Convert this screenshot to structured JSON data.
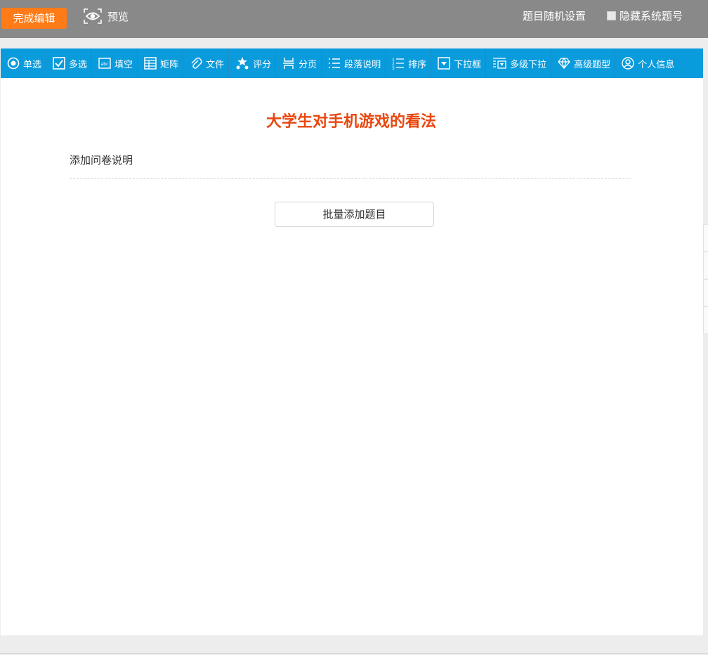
{
  "topbar": {
    "done_label": "完成编辑",
    "preview_label": "预览",
    "random_settings_label": "题目随机设置",
    "hide_numbers_label": "隐藏系统题号",
    "hide_numbers_checked": false,
    "bg_color": "#898989",
    "accent_color": "#ff7b17"
  },
  "toolbar": {
    "bg_color": "#0a9bdc",
    "items": [
      {
        "label": "单选",
        "icon": "radio-icon"
      },
      {
        "label": "多选",
        "icon": "checkbox-icon"
      },
      {
        "label": "填空",
        "icon": "text-field-icon"
      },
      {
        "label": "矩阵",
        "icon": "matrix-icon"
      },
      {
        "label": "文件",
        "icon": "paperclip-icon"
      },
      {
        "label": "评分",
        "icon": "stars-icon"
      },
      {
        "label": "分页",
        "icon": "page-break-icon"
      },
      {
        "label": "段落说明",
        "icon": "paragraph-icon"
      },
      {
        "label": "排序",
        "icon": "sort-icon"
      },
      {
        "label": "下拉框",
        "icon": "dropdown-icon"
      },
      {
        "label": "多级下拉",
        "icon": "cascade-dropdown-icon"
      },
      {
        "label": "高级题型",
        "icon": "diamond-icon"
      },
      {
        "label": "个人信息",
        "icon": "user-icon"
      }
    ]
  },
  "survey": {
    "title": "大学生对手机游戏的看法",
    "description_placeholder": "添加问卷说明",
    "batch_add_label": "批量添加题目",
    "title_color": "#e8470f"
  }
}
